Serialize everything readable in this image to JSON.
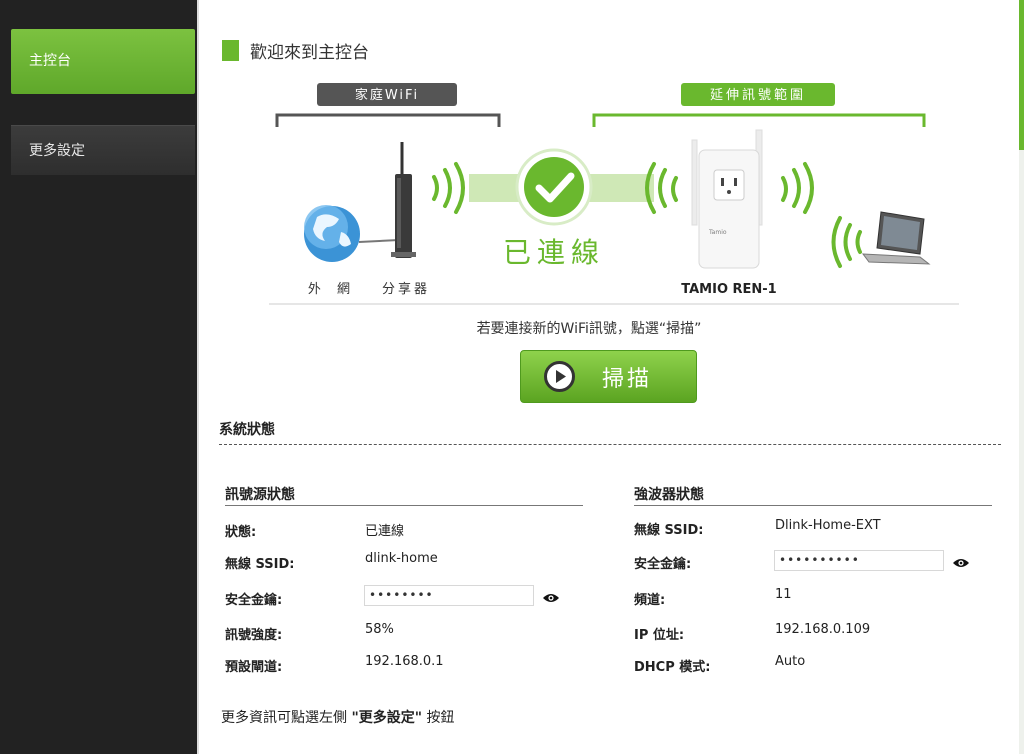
{
  "sidebar": {
    "items": [
      {
        "label": "主控台"
      },
      {
        "label": "更多設定"
      }
    ]
  },
  "page": {
    "title": "歡迎來到主控台"
  },
  "diagram": {
    "home_wifi_label": "家庭WiFi",
    "extend_label": "延伸訊號範圍",
    "connected_label": "已連線",
    "internet_label": "外 網",
    "router_label": "分享器",
    "device_label": "TAMIO REN-1",
    "device_brand": "Tamio"
  },
  "scan": {
    "hint": "若要連接新的WiFi訊號，點選“掃描”",
    "button_label": "掃描"
  },
  "system_status": {
    "title": "系統狀態",
    "source": {
      "title": "訊號源狀態",
      "status_label": "狀態:",
      "status_value": "已連線",
      "ssid_label": "無線 SSID:",
      "ssid_value": "dlink-home",
      "key_label": "安全金鑰:",
      "key_value": "••••••••",
      "strength_label": "訊號強度:",
      "strength_value": "58%",
      "gateway_label": "預設閘道:",
      "gateway_value": "192.168.0.1"
    },
    "extender": {
      "title": "強波器狀態",
      "ssid_label": "無線 SSID:",
      "ssid_value": "Dlink-Home-EXT",
      "key_label": "安全金鑰:",
      "key_value": "••••••••••",
      "channel_label": "頻道:",
      "channel_value": "11",
      "ip_label": "IP 位址:",
      "ip_value": "192.168.0.109",
      "dhcp_label": "DHCP 模式:",
      "dhcp_value": "Auto"
    }
  },
  "footer": {
    "prefix": "更多資訊可點選左側 ",
    "link_text": "\"更多設定\"",
    "suffix": " 按鈕"
  },
  "colors": {
    "accent": "#6ab82e",
    "sidebar_bg": "#222222"
  },
  "icons": {
    "globe": "globe-icon",
    "router": "router-icon",
    "check": "check-icon",
    "extender": "extender-icon",
    "laptop": "laptop-icon",
    "play": "play-icon",
    "eye": "eye-icon"
  }
}
